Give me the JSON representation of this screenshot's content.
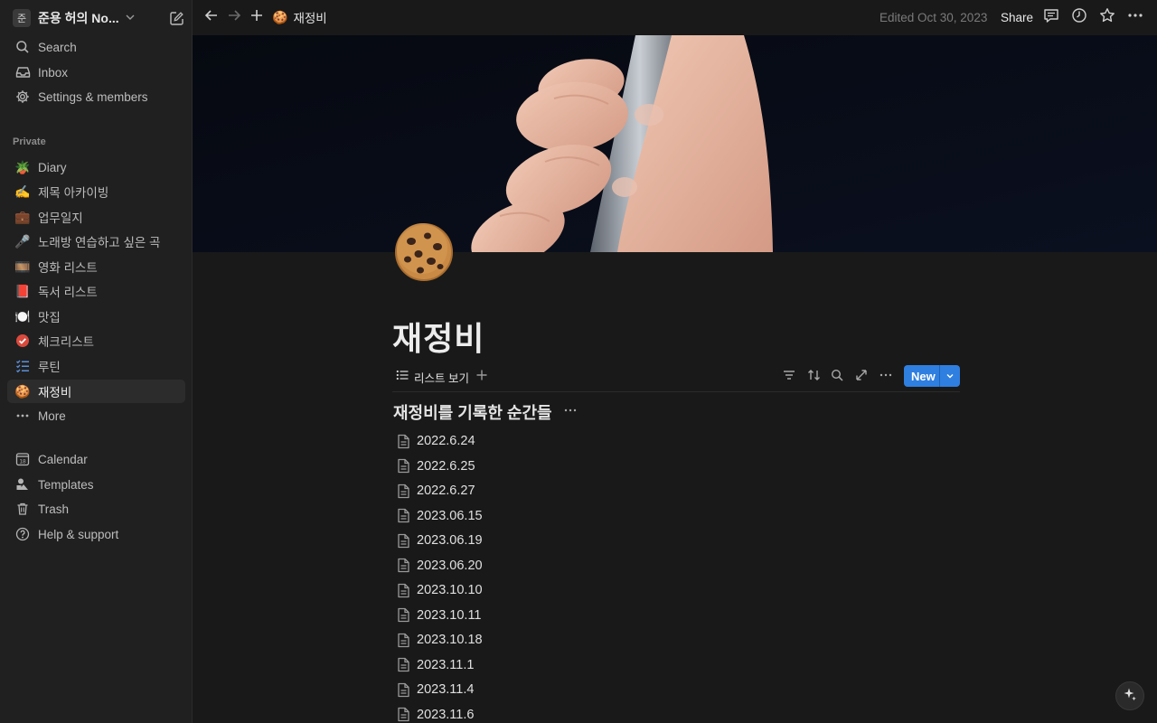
{
  "workspace": {
    "avatar": "준",
    "name": "준용 허의 No..."
  },
  "sidebar": {
    "top_items": [
      {
        "label": "Search",
        "icon": "search-icon"
      },
      {
        "label": "Inbox",
        "icon": "inbox-icon"
      },
      {
        "label": "Settings & members",
        "icon": "gear-icon"
      }
    ],
    "section_label": "Private",
    "pages": [
      {
        "label": "Diary",
        "emoji": "🪴"
      },
      {
        "label": "제목 아카이빙",
        "emoji": "✍️"
      },
      {
        "label": "업무일지",
        "emoji": "💼"
      },
      {
        "label": "노래방 연습하고 싶은 곡",
        "emoji": "🎤"
      },
      {
        "label": "영화 리스트",
        "emoji": "🎞️"
      },
      {
        "label": "독서 리스트",
        "emoji": "📕"
      },
      {
        "label": "맛집",
        "emoji": "🍽️"
      },
      {
        "label": "체크리스트",
        "emoji": "✔"
      },
      {
        "label": "루틴",
        "emoji": "☰"
      },
      {
        "label": "재정비",
        "emoji": "🍪"
      }
    ],
    "more_label": "More",
    "bottom_items": [
      {
        "label": "Calendar",
        "icon": "calendar-icon",
        "badge": "18"
      },
      {
        "label": "Templates",
        "icon": "templates-icon"
      },
      {
        "label": "Trash",
        "icon": "trash-icon"
      },
      {
        "label": "Help & support",
        "icon": "help-icon"
      }
    ]
  },
  "topbar": {
    "breadcrumb_emoji": "🍪",
    "breadcrumb_title": "재정비",
    "edited": "Edited Oct 30, 2023",
    "share_label": "Share"
  },
  "page": {
    "title": "재정비",
    "view_tab_label": "리스트 보기",
    "new_label": "New",
    "group_title": "재정비를 기록한 순간들",
    "entries": [
      "2022.6.24",
      "2022.6.25",
      "2022.6.27",
      "2023.06.15",
      "2023.06.19",
      "2023.06.20",
      "2023.10.10",
      "2023.10.11",
      "2023.10.18",
      "2023.11.1",
      "2023.11.4",
      "2023.11.6"
    ]
  },
  "colors": {
    "background": "#191919",
    "sidebar": "#202020",
    "accent": "#2f7fe0",
    "active_item": "#2c2c2c"
  }
}
